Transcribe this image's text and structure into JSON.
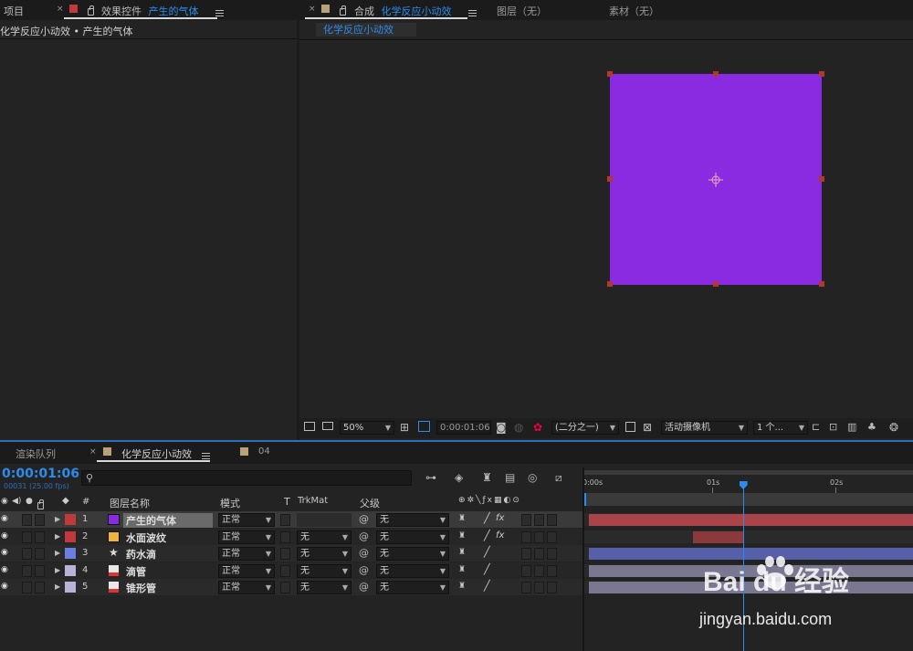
{
  "project_panel": {
    "tab": "项目",
    "breadcrumb": "化学反应小动效 • 产生的气体"
  },
  "effects_panel": {
    "tab_prefix": "效果控件",
    "layer_name": "产生的气体"
  },
  "comp_panel": {
    "tab_prefix": "合成",
    "comp_name": "化学反应小动效",
    "layer_tab": "图层（无）",
    "footage_tab": "素材（无）",
    "sub_tab": "化学反应小动效",
    "solid_color": "#8a2be2",
    "toolbar": {
      "zoom": "50%",
      "timecode": "0:00:01:06",
      "resolution": "(二分之一)",
      "camera": "活动摄像机",
      "views": "1 个..."
    }
  },
  "bottom_tabs": {
    "render_queue": "渲染队列",
    "comp": "化学反应小动效",
    "other": "04"
  },
  "timeline": {
    "timecode": "0:00:01:06",
    "frame_info": "00031 (25.00 fps)",
    "search_placeholder": "",
    "headers": {
      "hash": "#",
      "layer_name": "图层名称",
      "mode": "模式",
      "t": "T",
      "trkmat": "TrkMat",
      "parent": "父级"
    },
    "ruler": {
      "t0": "0:00s",
      "t1": "01s",
      "t2": "02s"
    },
    "playhead_seconds": 1.24,
    "layers": [
      {
        "num": "1",
        "name": "产生的气体",
        "label_color": "#c0393b",
        "swatch": "#8a2be2",
        "icon": "solid",
        "mode": "正常",
        "trkmat": "",
        "parent": "无",
        "has_fx": true,
        "selected": true,
        "bar_color": "#a8444a",
        "bar_start": 0.0,
        "bar_end": 1.0
      },
      {
        "num": "2",
        "name": "水面波纹",
        "label_color": "#c0393b",
        "swatch": "#f0b43c",
        "icon": "solid",
        "mode": "正常",
        "trkmat": "无",
        "parent": "无",
        "has_fx": true,
        "selected": false,
        "bar_color": "#8a3a3a",
        "bar_start": 0.32,
        "bar_end": 0.48
      },
      {
        "num": "3",
        "name": "药水滴",
        "label_color": "#6b7fe0",
        "swatch": "",
        "icon": "star",
        "mode": "正常",
        "trkmat": "无",
        "parent": "无",
        "has_fx": false,
        "selected": false,
        "bar_color": "#5560a8",
        "bar_start": 0.0,
        "bar_end": 1.0
      },
      {
        "num": "4",
        "name": "滴管",
        "label_color": "#b7b3d6",
        "swatch": "",
        "icon": "ai",
        "mode": "正常",
        "trkmat": "无",
        "parent": "无",
        "has_fx": false,
        "selected": false,
        "bar_color": "#7a7890",
        "bar_start": 0.0,
        "bar_end": 1.0
      },
      {
        "num": "5",
        "name": "锥形管",
        "label_color": "#b7b3d6",
        "swatch": "",
        "icon": "ai",
        "mode": "正常",
        "trkmat": "无",
        "parent": "无",
        "has_fx": false,
        "selected": false,
        "bar_color": "#7a7890",
        "bar_start": 0.0,
        "bar_end": 1.0
      }
    ]
  },
  "watermark": {
    "text_logo": "Bai du 经验",
    "url": "jingyan.baidu.com"
  }
}
